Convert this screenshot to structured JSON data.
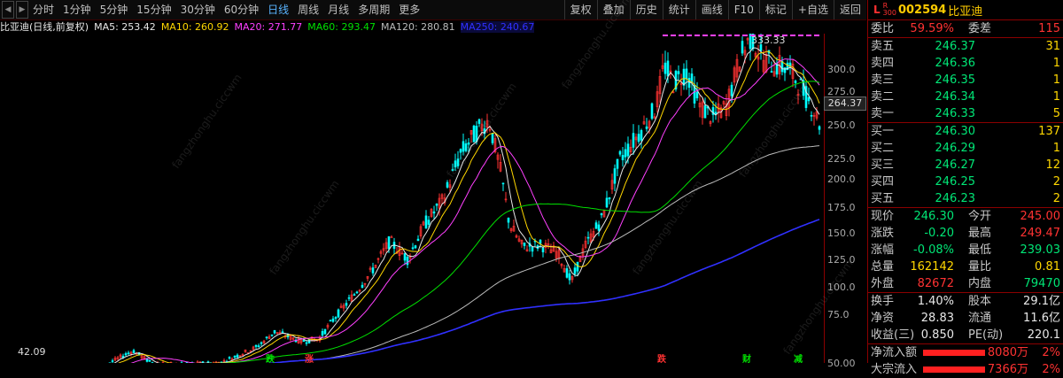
{
  "toolbar": {
    "periods": [
      "分时",
      "1分钟",
      "5分钟",
      "15分钟",
      "30分钟",
      "60分钟",
      "日线",
      "周线",
      "月线",
      "多周期",
      "更多"
    ],
    "active_period": "日线",
    "tools": [
      "复权",
      "叠加",
      "历史",
      "统计",
      "画线",
      "F10",
      "标记",
      "+自选",
      "返回"
    ]
  },
  "legend": {
    "title": "比亚迪(日线,前复权)",
    "ma5": "MA5: 253.42",
    "ma10": "MA10: 260.92",
    "ma20": "MA20: 271.77",
    "ma60": "MA60: 293.47",
    "ma120": "MA120: 280.81",
    "ma250": "MA250: 240.67"
  },
  "colors": {
    "ma5": "#e8e8e8",
    "ma10": "#ffd700",
    "ma20": "#ff40ff",
    "ma60": "#00e000",
    "ma120": "#bbbbbb",
    "ma250": "#3030ff",
    "up": "#ff3232",
    "down": "#00ffff"
  },
  "chart_data": {
    "type": "candlestick",
    "y_ticks": [
      "300.0",
      "275.0",
      "250.0",
      "225.0",
      "200.0",
      "175.0",
      "150.0",
      "125.0",
      "100.0",
      "75.0",
      "50.00"
    ],
    "high_label": "333.33",
    "low_label": "42.09",
    "current_price_flag": "264.37",
    "signals": [
      "跌",
      "涨",
      "跌",
      "财",
      "减"
    ]
  },
  "watermark": "fangzhonghu.ciccwm",
  "quote": {
    "l_mark": "L",
    "r_mark": "R",
    "r_sub": "300",
    "code": "002594",
    "name": "比亚迪",
    "weibi_label": "委比",
    "weibi": "59.59%",
    "weicha_label": "委差",
    "weicha": "115",
    "asks": [
      {
        "label": "卖五",
        "price": "246.37",
        "vol": "31"
      },
      {
        "label": "卖四",
        "price": "246.36",
        "vol": "1"
      },
      {
        "label": "卖三",
        "price": "246.35",
        "vol": "1"
      },
      {
        "label": "卖二",
        "price": "246.34",
        "vol": "1"
      },
      {
        "label": "卖一",
        "price": "246.33",
        "vol": "5"
      }
    ],
    "bids": [
      {
        "label": "买一",
        "price": "246.30",
        "vol": "137"
      },
      {
        "label": "买二",
        "price": "246.29",
        "vol": "1"
      },
      {
        "label": "买三",
        "price": "246.27",
        "vol": "12"
      },
      {
        "label": "买四",
        "price": "246.25",
        "vol": "2"
      },
      {
        "label": "买五",
        "price": "246.23",
        "vol": "2"
      }
    ],
    "stats": [
      {
        "l1": "现价",
        "v1": "246.30",
        "c1": "green",
        "l2": "今开",
        "v2": "245.00",
        "c2": "red"
      },
      {
        "l1": "涨跌",
        "v1": "-0.20",
        "c1": "green",
        "l2": "最高",
        "v2": "249.47",
        "c2": "red"
      },
      {
        "l1": "涨幅",
        "v1": "-0.08%",
        "c1": "green",
        "l2": "最低",
        "v2": "239.03",
        "c2": "green"
      },
      {
        "l1": "总量",
        "v1": "162142",
        "c1": "yellow",
        "l2": "量比",
        "v2": "0.81",
        "c2": "yellow"
      },
      {
        "l1": "外盘",
        "v1": "82672",
        "c1": "red",
        "l2": "内盘",
        "v2": "79470",
        "c2": "green"
      }
    ],
    "fundamentals": [
      {
        "l1": "换手",
        "v1": "1.40%",
        "l2": "股本",
        "v2": "29.1亿"
      },
      {
        "l1": "净资",
        "v1": "28.83",
        "l2": "流通",
        "v2": "11.6亿"
      },
      {
        "l1": "收益(三)",
        "v1": "0.850",
        "l2": "PE(动)",
        "v2": "220.1"
      }
    ],
    "flows": [
      {
        "label": "净流入额",
        "value": "8080万",
        "pct": "2%"
      },
      {
        "label": "大宗流入",
        "value": "7366万",
        "pct": "2%"
      }
    ]
  }
}
